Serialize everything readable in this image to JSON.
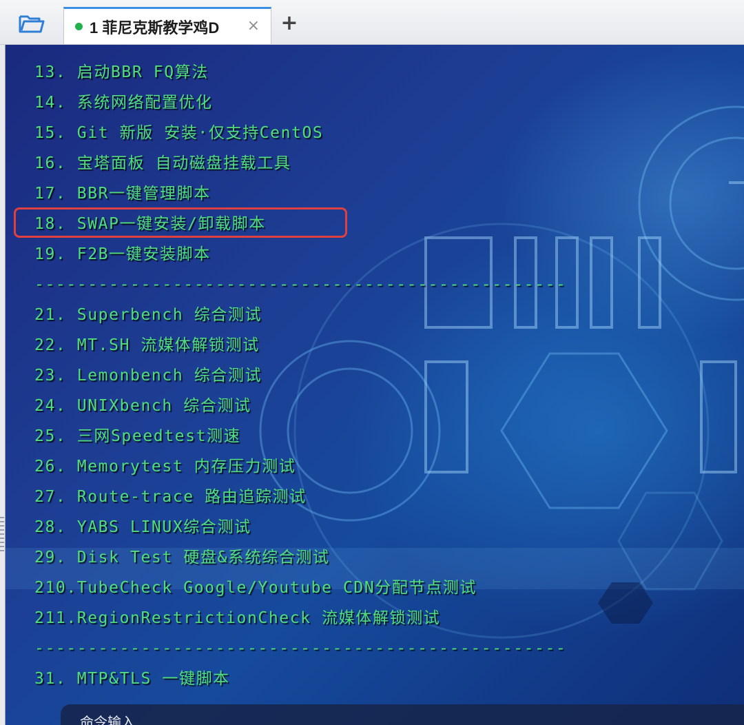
{
  "tabbar": {
    "tab_label": "1 菲尼克斯教学鸡D",
    "close_glyph": "×",
    "add_glyph": "+",
    "status_color": "#22b24c"
  },
  "terminal": {
    "lines": [
      "13. 启动BBR FQ算法",
      "14. 系统网络配置优化",
      "15. Git 新版 安装·仅支持CentOS",
      "16. 宝塔面板 自动磁盘挂载工具",
      "17. BBR一键管理脚本",
      "18. SWAP一键安装/卸载脚本",
      "19. F2B一键安装脚本",
      "--------------------------------------------------",
      "21. Superbench 综合测试",
      "22. MT.SH 流媒体解锁测试",
      "23. Lemonbench 综合测试",
      "24. UNIXbench 综合测试",
      "25. 三网Speedtest测速",
      "26. Memorytest 内存压力测试",
      "27. Route-trace 路由追踪测试",
      "28. YABS LINUX综合测试",
      "29. Disk Test 硬盘&系统综合测试",
      "210.TubeCheck Google/Youtube CDN分配节点测试",
      "211.RegionRestrictionCheck 流媒体解锁测试",
      "--------------------------------------------------",
      "31. MTP&TLS 一键脚本"
    ],
    "highlighted_item": "18",
    "text_color": "#52dd7c",
    "highlight_color": "#e0403f"
  },
  "command_bar": {
    "label": "命令输入"
  }
}
